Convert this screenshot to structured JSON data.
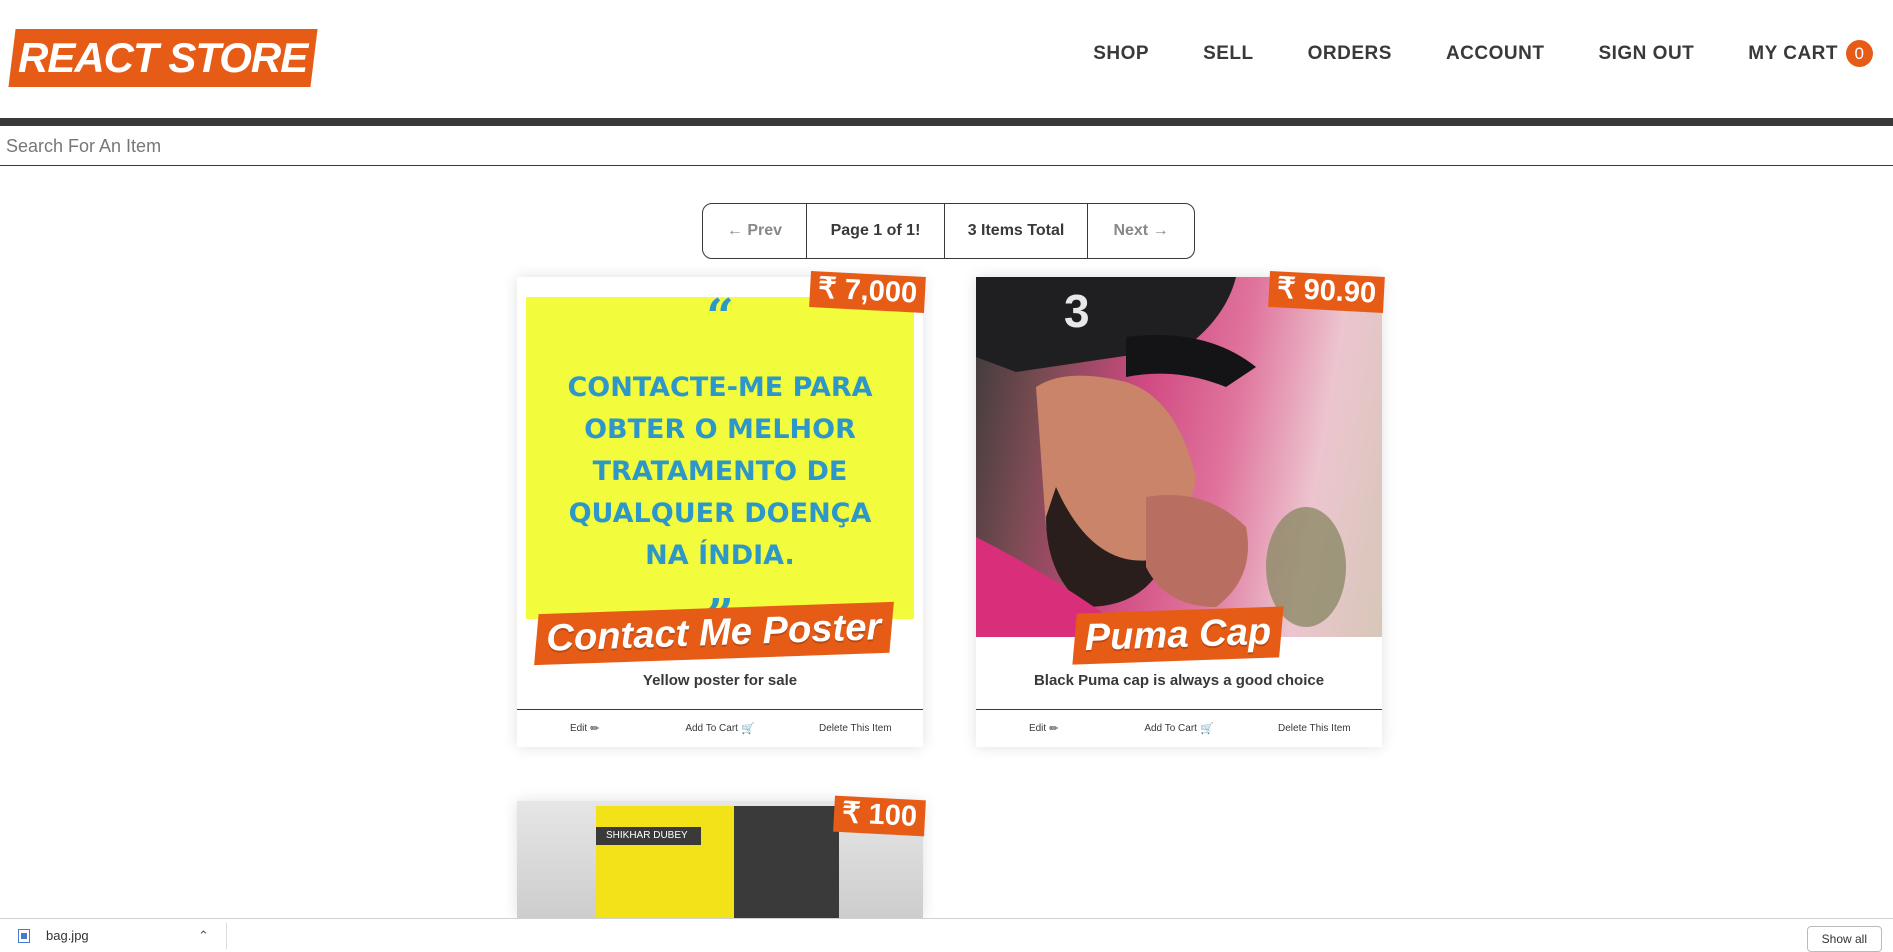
{
  "header": {
    "logo": "REACT STORE",
    "nav": [
      "SHOP",
      "SELL",
      "ORDERS",
      "ACCOUNT",
      "SIGN OUT"
    ],
    "cart_label": "MY CART",
    "cart_count": "0"
  },
  "search": {
    "placeholder": "Search For An Item"
  },
  "pagination": {
    "prev": "← Prev",
    "page": "Page 1 of 1!",
    "total": "3 Items Total",
    "next": "Next →"
  },
  "items": [
    {
      "title": "Contact Me Poster",
      "price": "₹ 7,000",
      "description": "Yellow poster for sale",
      "image_text": "CONTACTE-ME PARA OBTER O MELHOR TRATAMENTO DE QUALQUER DOENÇA NA ÍNDIA.",
      "edit": "Edit",
      "add_to_cart": "Add To Cart",
      "delete": "Delete This Item"
    },
    {
      "title": "Puma Cap",
      "price": "₹ 90.90",
      "description": "Black Puma cap is always a good choice",
      "edit": "Edit",
      "add_to_cart": "Add To Cart",
      "delete": "Delete This Item"
    },
    {
      "price": "₹ 100",
      "image_text": "SHIKHAR DUBEY"
    }
  ],
  "download_bar": {
    "file_name": "bag.jpg",
    "show_all": "Show all"
  }
}
